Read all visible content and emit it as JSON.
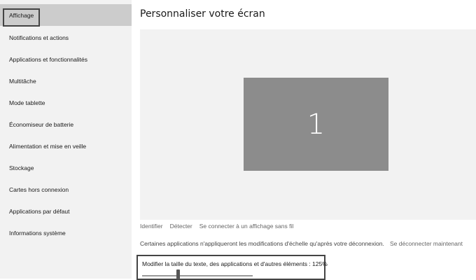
{
  "sidebar": {
    "items": [
      {
        "label": "Affichage",
        "selected": true
      },
      {
        "label": "Notifications et actions"
      },
      {
        "label": "Applications et fonctionnalités"
      },
      {
        "label": "Multitâche"
      },
      {
        "label": "Mode tablette"
      },
      {
        "label": "Économiseur de batterie"
      },
      {
        "label": "Alimentation et mise en veille"
      },
      {
        "label": "Stockage"
      },
      {
        "label": "Cartes hors connexion"
      },
      {
        "label": "Applications par défaut"
      },
      {
        "label": "Informations système"
      }
    ]
  },
  "main": {
    "title": "Personnaliser votre écran",
    "monitor_number": "1",
    "links": {
      "identify": "Identifier",
      "detect": "Détecter",
      "connect": "Se connecter à un affichage sans fil"
    },
    "note": "Certaines applications n'appliqueront les modifications d'échelle qu'après votre déconnexion.",
    "signout_link": "Se déconnecter maintenant",
    "scale": {
      "label": "Modifier la taille du texte, des applications et d'autres éléments : 125%",
      "value_percent": 125
    }
  },
  "colors": {
    "sidebar_bg": "#f2f2f2",
    "selected_bg": "#cccccc",
    "monitor_bg": "#8c8c8c",
    "preview_bg": "#f2f2f2"
  }
}
